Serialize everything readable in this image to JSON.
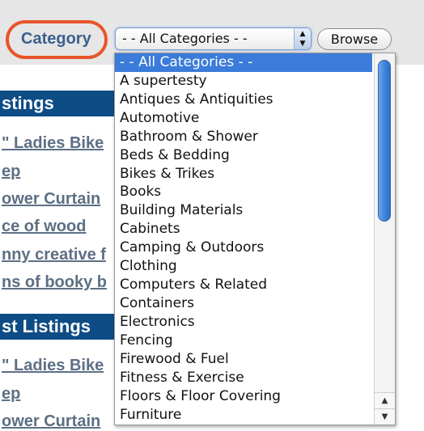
{
  "filter": {
    "label": "Category",
    "selected_value": "- - All Categories - -",
    "browse_label": "Browse",
    "arrow_up": "▲",
    "arrow_down": "▼"
  },
  "background": {
    "section1_title": "stings",
    "section1_links": [
      "\" Ladies Bike",
      "ep",
      "ower Curtain",
      "ce of wood",
      "nny creative f",
      "ns of booky b"
    ],
    "section2_title": "st Listings",
    "section2_links": [
      "\" Ladies Bike",
      "ep",
      "ower Curtain"
    ]
  },
  "dropdown": {
    "options": [
      "- - All Categories - -",
      "A supertesty",
      "Antiques & Antiquities",
      "Automotive",
      "Bathroom & Shower",
      "Beds & Bedding",
      "Bikes & Trikes",
      "Books",
      "Building Materials",
      "Cabinets",
      "Camping & Outdoors",
      "Clothing",
      "Computers & Related",
      "Containers",
      "Electronics",
      "Fencing",
      "Firewood & Fuel",
      "Fitness & Exercise",
      "Floors & Floor Covering",
      "Furniture"
    ],
    "scroll_up_arrow": "▲",
    "scroll_down_arrow": "▼"
  },
  "colors": {
    "highlight": "#e8542a",
    "label": "#3b5f8c",
    "header": "#0e4c86",
    "selected_option": "#3b7bd9"
  }
}
